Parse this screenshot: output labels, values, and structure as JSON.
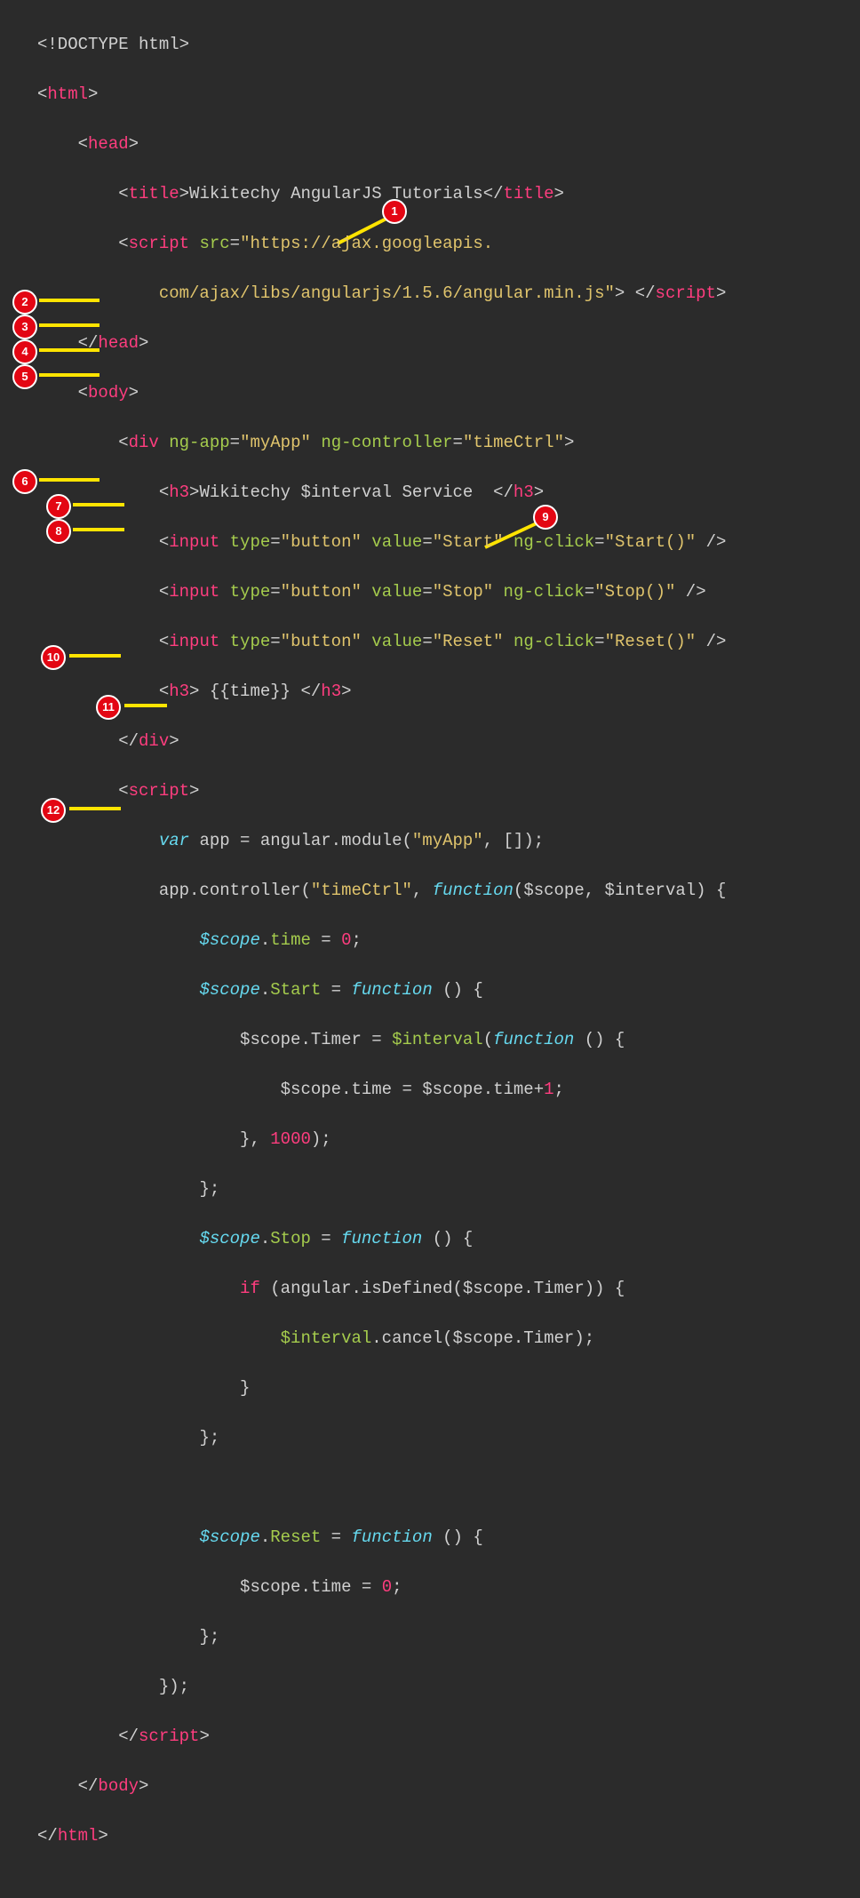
{
  "markers": {
    "m1": "1",
    "m2": "2",
    "m3": "3",
    "m4": "4",
    "m5": "5",
    "m6": "6",
    "m7": "7",
    "m8": "8",
    "m9": "9",
    "m10": "10",
    "m11": "11",
    "m12": "12"
  },
  "code": {
    "l01_a": "<!DOCTYPE html>",
    "l02_a": "<",
    "l02_b": "html",
    "l02_c": ">",
    "l03_a": "<",
    "l03_b": "head",
    "l03_c": ">",
    "l04_a": "<",
    "l04_b": "title",
    "l04_c": ">",
    "l04_d": "Wikitechy AngularJS Tutorials",
    "l04_e": "</",
    "l04_f": "title",
    "l04_g": ">",
    "l05_a": "<",
    "l05_b": "script",
    "l05_c": " ",
    "l05_d": "src",
    "l05_e": "=",
    "l05_f": "\"https://ajax.googleapis.",
    "l06_a": "com/ajax/libs/angularjs/1.5.6/angular.min.js\"",
    "l06_b": ">",
    "l06_c": " ",
    "l06_d": "</",
    "l06_e": "script",
    "l06_f": ">",
    "l07_a": "</",
    "l07_b": "head",
    "l07_c": ">",
    "l08_a": "<",
    "l08_b": "body",
    "l08_c": ">",
    "l09_a": "<",
    "l09_b": "div",
    "l09_c": " ",
    "l09_d": "ng-app",
    "l09_e": "=",
    "l09_f": "\"myApp\"",
    "l09_g": " ",
    "l09_h": "ng-controller",
    "l09_i": "=",
    "l09_j": "\"timeCtrl\"",
    "l09_k": ">",
    "l10_a": "<",
    "l10_b": "h3",
    "l10_c": ">",
    "l10_d": "Wikitechy $interval Service  ",
    "l10_e": "</",
    "l10_f": "h3",
    "l10_g": ">",
    "l11_a": "<",
    "l11_b": "input",
    "l11_c": " ",
    "l11_d": "type",
    "l11_e": "=",
    "l11_f": "\"button\"",
    "l11_g": " ",
    "l11_h": "value",
    "l11_i": "=",
    "l11_j": "\"Start\"",
    "l11_k": " ",
    "l11_l": "ng-click",
    "l11_m": "=",
    "l11_n": "\"Start()\"",
    "l11_o": " />",
    "l12_a": "<",
    "l12_b": "input",
    "l12_c": " ",
    "l12_d": "type",
    "l12_e": "=",
    "l12_f": "\"button\"",
    "l12_g": " ",
    "l12_h": "value",
    "l12_i": "=",
    "l12_j": "\"Stop\"",
    "l12_k": " ",
    "l12_l": "ng-click",
    "l12_m": "=",
    "l12_n": "\"Stop()\"",
    "l12_o": " />",
    "l13_a": "<",
    "l13_b": "input",
    "l13_c": " ",
    "l13_d": "type",
    "l13_e": "=",
    "l13_f": "\"button\"",
    "l13_g": " ",
    "l13_h": "value",
    "l13_i": "=",
    "l13_j": "\"Reset\"",
    "l13_k": " ",
    "l13_l": "ng-click",
    "l13_m": "=",
    "l13_n": "\"Reset()\"",
    "l13_o": " />",
    "l14_a": "<",
    "l14_b": "h3",
    "l14_c": ">",
    "l14_d": " {{time}} ",
    "l14_e": "</",
    "l14_f": "h3",
    "l14_g": ">",
    "l15_a": "</",
    "l15_b": "div",
    "l15_c": ">",
    "l16_a": "<",
    "l16_b": "script",
    "l16_c": ">",
    "l17_a": "var",
    "l17_b": " app = angular.module(",
    "l17_c": "\"myApp\"",
    "l17_d": ", []);",
    "l18_a": "app.controller(",
    "l18_b": "\"timeCtrl\"",
    "l18_c": ", ",
    "l18_d": "function",
    "l18_e": "($scope, $interval) {",
    "l19_a": "$scope",
    "l19_b": ".",
    "l19_c": "time",
    "l19_d": " = ",
    "l19_e": "0",
    "l19_f": ";",
    "l20_a": "$scope",
    "l20_b": ".",
    "l20_c": "Start",
    "l20_d": " = ",
    "l20_e": "function",
    "l20_f": " () {",
    "l21_a": "$scope.Timer = ",
    "l21_b": "$interval",
    "l21_c": "(",
    "l21_d": "function",
    "l21_e": " () {",
    "l22_a": "$scope.time = $scope.time+",
    "l22_b": "1",
    "l22_c": ";",
    "l23_a": "}, ",
    "l23_b": "1000",
    "l23_c": ");",
    "l24_a": "};",
    "l25_a": "$scope",
    "l25_b": ".",
    "l25_c": "Stop",
    "l25_d": " = ",
    "l25_e": "function",
    "l25_f": " () {",
    "l26_a": "if",
    "l26_b": " (angular.isDefined($scope.Timer)) {",
    "l27_a": "$interval",
    "l27_b": ".cancel($scope.Timer);",
    "l28_a": "}",
    "l29_a": "};",
    "l30_blank": "",
    "l31_a": "$scope",
    "l31_b": ".",
    "l31_c": "Reset",
    "l31_d": " = ",
    "l31_e": "function",
    "l31_f": " () {",
    "l32_a": "$scope.time = ",
    "l32_b": "0",
    "l32_c": ";",
    "l33_a": "};",
    "l34_a": "});",
    "l35_a": "</",
    "l35_b": "script",
    "l35_c": ">",
    "l36_a": "</",
    "l36_b": "body",
    "l36_c": ">",
    "l37_a": "</",
    "l37_b": "html",
    "l37_c": ">"
  }
}
